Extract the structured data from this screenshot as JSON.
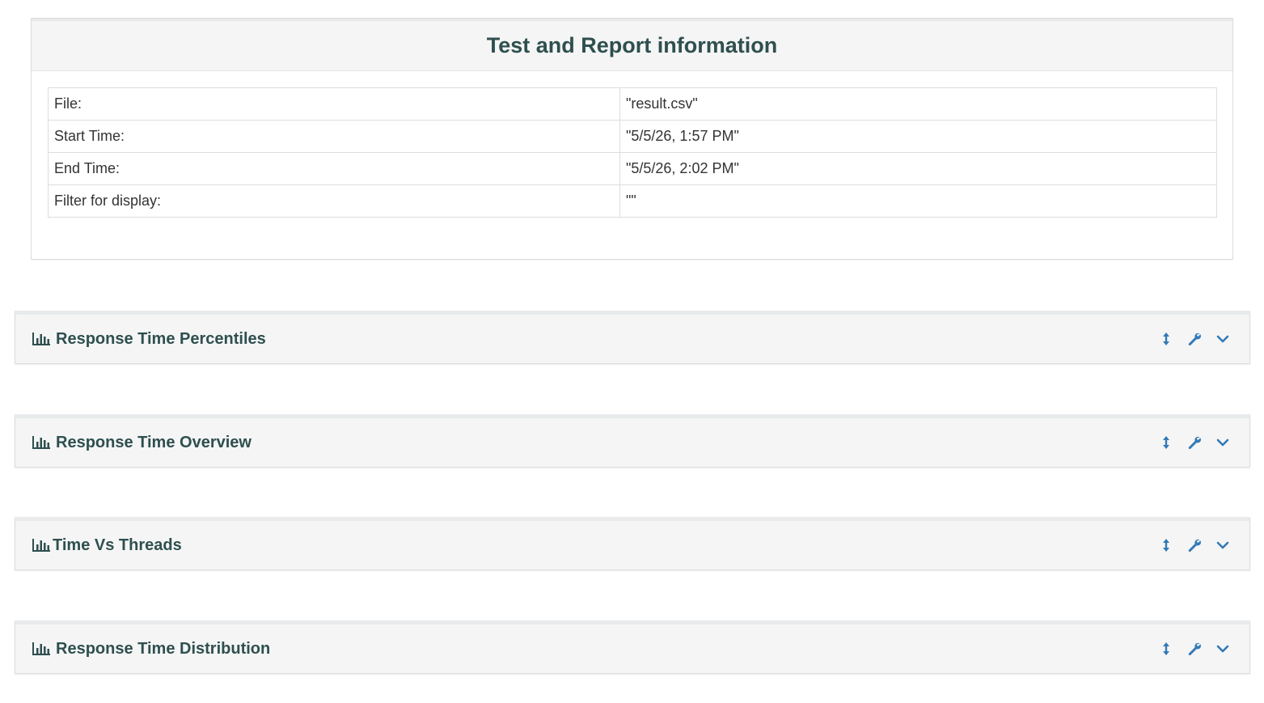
{
  "info_panel": {
    "title": "Test and Report information",
    "rows": [
      {
        "label": "File:",
        "value": "\"result.csv\""
      },
      {
        "label": "Start Time:",
        "value": "\"5/5/26, 1:57 PM\""
      },
      {
        "label": "End Time:",
        "value": "\"5/5/26, 2:02 PM\""
      },
      {
        "label": "Filter for display:",
        "value": "\"\""
      }
    ]
  },
  "panels": [
    {
      "title": "Response Time Percentiles"
    },
    {
      "title": "Response Time Overview"
    },
    {
      "title": "Time Vs Threads"
    },
    {
      "title": "Response Time Distribution"
    }
  ],
  "icons": {
    "panel_icon": "bar-chart-icon",
    "tools": [
      "resize-vertical-icon",
      "wrench-icon",
      "chevron-down-icon"
    ]
  },
  "colors": {
    "title": "#2f4f4f",
    "tool_icon": "#337ab7",
    "panel_bg": "#f5f5f5"
  }
}
